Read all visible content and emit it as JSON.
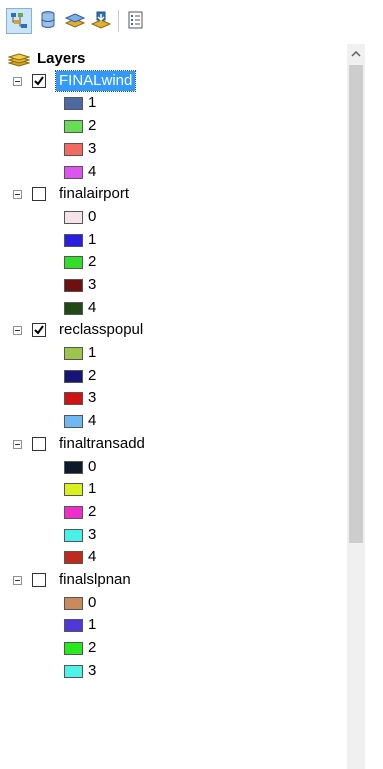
{
  "toolbar": {
    "buttons": [
      {
        "name": "list-by-drawing-order-icon",
        "active": true
      },
      {
        "name": "list-by-source-icon",
        "active": false
      },
      {
        "name": "list-by-visibility-icon",
        "active": false
      },
      {
        "name": "list-by-selection-icon",
        "active": false
      },
      {
        "name": "options-icon",
        "active": false
      }
    ]
  },
  "toc": {
    "root_label": "Layers",
    "layers": [
      {
        "name": "FINALwind",
        "checked": true,
        "selected": true,
        "classes": [
          {
            "label": "1",
            "color": "#4a6aa0"
          },
          {
            "label": "2",
            "color": "#66dd55"
          },
          {
            "label": "3",
            "color": "#f06b63"
          },
          {
            "label": "4",
            "color": "#dd55ee"
          }
        ]
      },
      {
        "name": "finalairport",
        "checked": false,
        "selected": false,
        "classes": [
          {
            "label": "0",
            "color": "#f6e3ea"
          },
          {
            "label": "1",
            "color": "#2a1fe0"
          },
          {
            "label": "2",
            "color": "#33dd2a"
          },
          {
            "label": "3",
            "color": "#6e0f10"
          },
          {
            "label": "4",
            "color": "#1f4a14"
          }
        ]
      },
      {
        "name": "reclasspopul",
        "checked": true,
        "selected": false,
        "classes": [
          {
            "label": "1",
            "color": "#9dc44c"
          },
          {
            "label": "2",
            "color": "#151578"
          },
          {
            "label": "3",
            "color": "#d01212"
          },
          {
            "label": "4",
            "color": "#6fb8f2"
          }
        ]
      },
      {
        "name": "finaltransadd",
        "checked": false,
        "selected": false,
        "classes": [
          {
            "label": "0",
            "color": "#0e1a2a"
          },
          {
            "label": "1",
            "color": "#d9f01e"
          },
          {
            "label": "2",
            "color": "#ee2ec9"
          },
          {
            "label": "3",
            "color": "#49f1e8"
          },
          {
            "label": "4",
            "color": "#c02a1c"
          }
        ]
      },
      {
        "name": "finalslpnan",
        "checked": false,
        "selected": false,
        "classes": [
          {
            "label": "0",
            "color": "#c98a5e"
          },
          {
            "label": "1",
            "color": "#4f38d8"
          },
          {
            "label": "2",
            "color": "#27ea1e"
          },
          {
            "label": "3",
            "color": "#4ef2e6"
          }
        ]
      }
    ]
  }
}
